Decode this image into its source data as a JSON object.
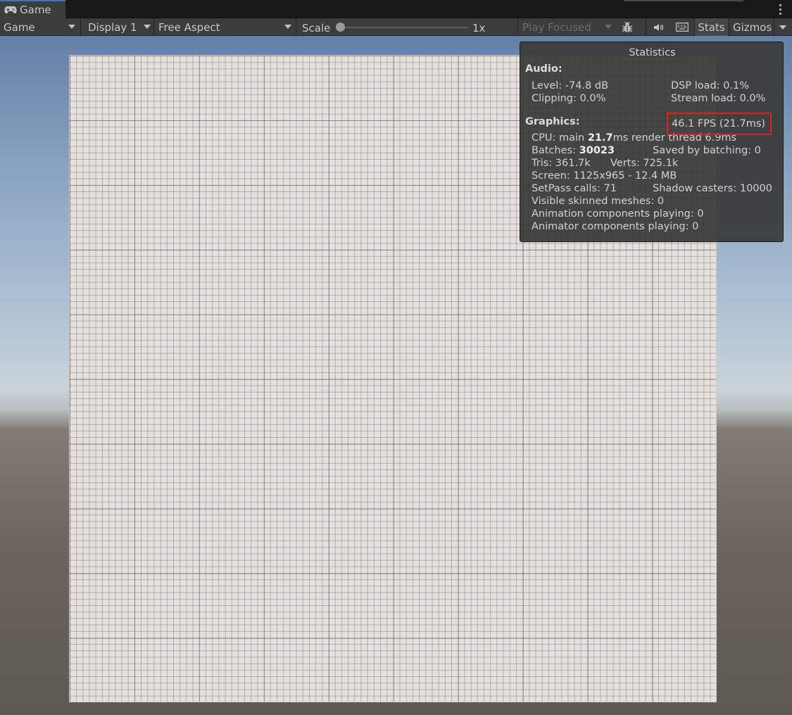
{
  "tab": {
    "title": "Game",
    "icon": "gamepad-icon"
  },
  "toolbar": {
    "view_mode": "Game",
    "display": "Display 1",
    "aspect": "Free Aspect",
    "scale_label": "Scale",
    "scale_value": "1x",
    "play_mode": "Play Focused",
    "stats_label": "Stats",
    "gizmos_label": "Gizmos"
  },
  "stats": {
    "title": "Statistics",
    "audio_header": "Audio:",
    "level": "Level: -74.8 dB",
    "clipping": "Clipping: 0.0%",
    "dsp_load": "DSP load: 0.1%",
    "stream_load": "Stream load: 0.0%",
    "graphics_header": "Graphics:",
    "fps": "46.1 FPS (21.7ms)",
    "cpu_prefix": "CPU: main ",
    "cpu_main": "21.7",
    "cpu_suffix": "ms  render thread 6.9ms",
    "batches_prefix": "Batches: ",
    "batches": "30023",
    "saved_by_batching": "Saved by batching: 0",
    "tris": "Tris: 361.7k",
    "verts": "Verts: 725.1k",
    "screen": "Screen: 1125x965 - 12.4 MB",
    "setpass": "SetPass calls: 71",
    "shadow_casters": "Shadow casters: 10000",
    "skinned_meshes": "Visible skinned meshes: 0",
    "animation_components": "Animation components playing: 0",
    "animator_components": "Animator components playing: 0"
  },
  "colors": {
    "highlight": "#e0221d",
    "tab_accent": "#3a79bb",
    "panel_bg": "#3c3c3c"
  }
}
